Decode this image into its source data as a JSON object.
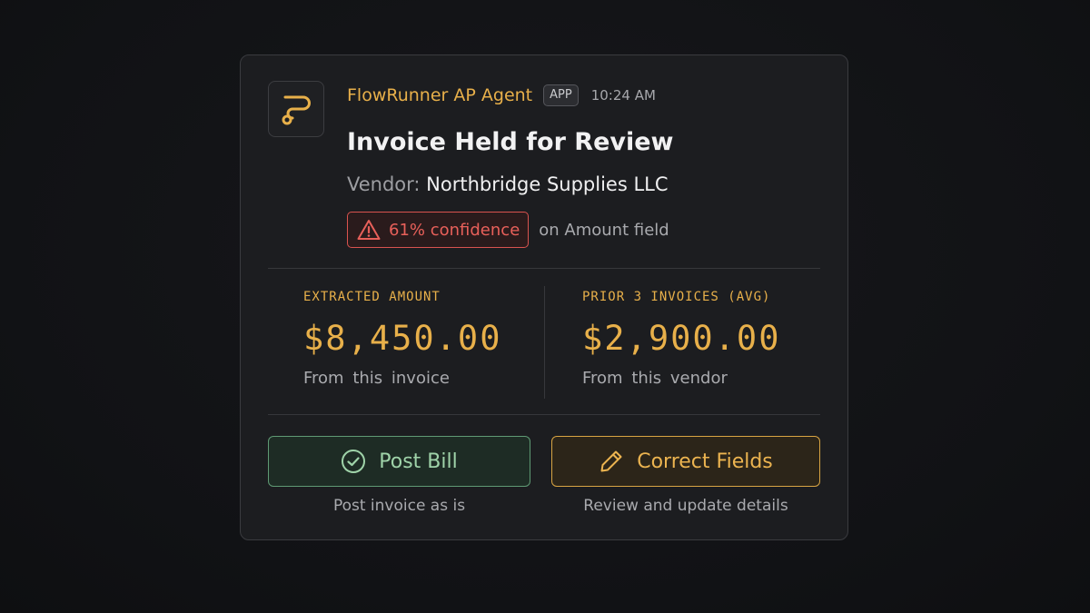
{
  "message": {
    "app_name": "FlowRunner AP Agent",
    "app_badge": "APP",
    "timestamp": "10:24 AM",
    "app_icon": "flow-route-icon",
    "title": "Invoice Held for Review",
    "vendor_label": "Vendor:",
    "vendor_name": "Northbridge Supplies LLC",
    "confidence": {
      "icon": "warning-triangle-icon",
      "text": "61% confidence",
      "suffix": "on Amount field"
    },
    "stats": [
      {
        "label": "EXTRACTED AMOUNT",
        "value": "$8,450.00",
        "sub": "From this invoice"
      },
      {
        "label": "PRIOR 3 INVOICES (AVG)",
        "value": "$2,900.00",
        "sub": "From this vendor"
      }
    ],
    "actions": {
      "post": {
        "icon": "check-circle-icon",
        "label": "Post Bill",
        "caption": "Post invoice as is"
      },
      "correct": {
        "icon": "pencil-icon",
        "label": "Correct Fields",
        "caption": "Review and update details"
      }
    }
  },
  "colors": {
    "accent": "#e8b04a",
    "warning": "#e8605a",
    "success": "#9fd3a9",
    "background": "#1c1d20"
  }
}
